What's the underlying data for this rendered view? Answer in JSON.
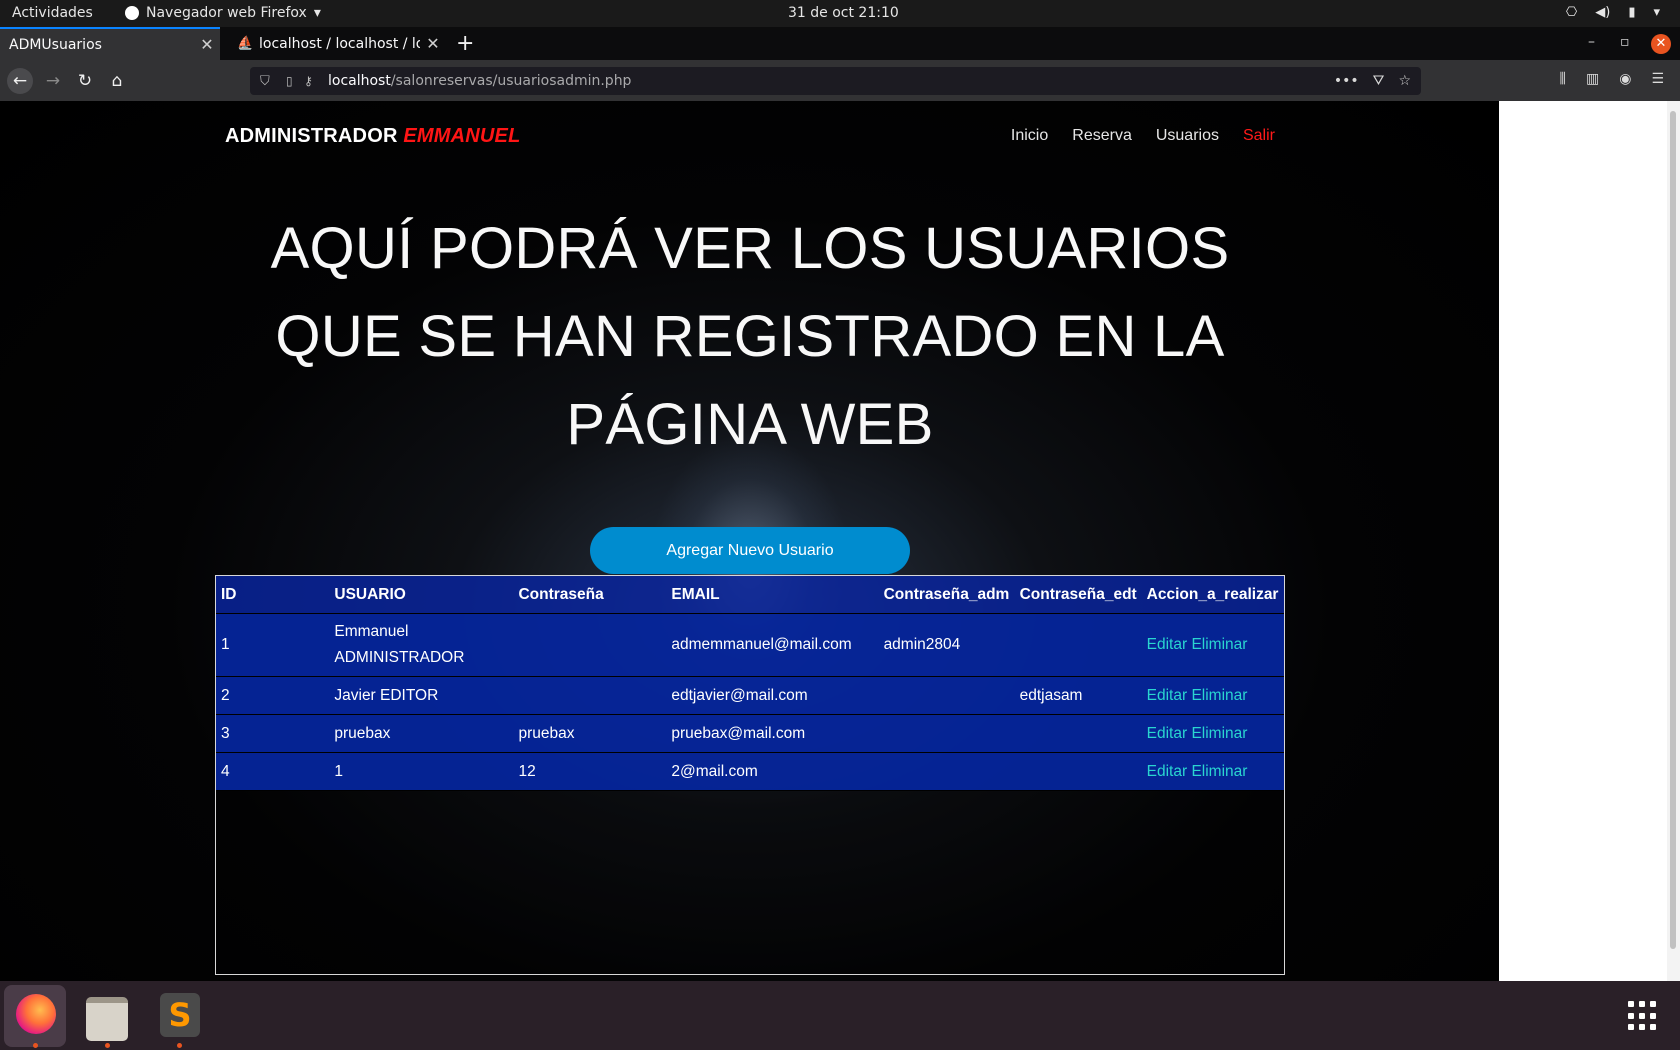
{
  "system": {
    "activities": "Actividades",
    "app_menu": "Navegador web Firefox",
    "clock": "31 de oct  21:10"
  },
  "browser": {
    "tabs": [
      {
        "title": "ADMUsuarios",
        "active": true
      },
      {
        "title": "localhost / localhost / loc",
        "active": false
      }
    ],
    "url_host": "localhost",
    "url_path": "/salonreservas/usuariosadmin.php"
  },
  "site": {
    "brand_prefix": "ADMINISTRADOR",
    "brand_name": "EMMANUEL",
    "nav": [
      "Inicio",
      "Reserva",
      "Usuarios",
      "Salir"
    ],
    "headline": "AQUÍ PODRÁ VER LOS USUARIOS QUE SE HAN REGISTRADO EN LA PÁGINA WEB",
    "add_button": "Agregar Nuevo Usuario",
    "table": {
      "headers": [
        "ID",
        "USUARIO",
        "Contraseña",
        "EMAIL",
        "Contraseña_adm",
        "Contraseña_edt",
        "Accion_a_realizar"
      ],
      "rows": [
        {
          "id": "1",
          "usuario": "Emmanuel ADMINISTRADOR",
          "contrasena": "",
          "email": "admemmanuel@mail.com",
          "contrasena_adm": "admin2804",
          "contrasena_edt": "",
          "editar": "Editar",
          "eliminar": "Eliminar"
        },
        {
          "id": "2",
          "usuario": "Javier EDITOR",
          "contrasena": "",
          "email": "edtjavier@mail.com",
          "contrasena_adm": "",
          "contrasena_edt": "edtjasam",
          "editar": "Editar",
          "eliminar": "Eliminar"
        },
        {
          "id": "3",
          "usuario": "pruebax",
          "contrasena": "pruebax",
          "email": "pruebax@mail.com",
          "contrasena_adm": "",
          "contrasena_edt": "",
          "editar": "Editar",
          "eliminar": "Eliminar"
        },
        {
          "id": "4",
          "usuario": "1",
          "contrasena": "12",
          "email": "2@mail.com",
          "contrasena_adm": "",
          "contrasena_edt": "",
          "editar": "Editar",
          "eliminar": "Eliminar"
        }
      ]
    }
  },
  "colors": {
    "brand_accent": "#ff1515",
    "button_blue": "#008ccf",
    "table_blue": "#0526a0",
    "action_link": "#2ad5d0"
  },
  "icons": [
    "firefox-icon",
    "files-icon",
    "sublime-text-icon",
    "app-grid-icon",
    "shield-icon",
    "star-icon",
    "pocket-icon",
    "library-icon",
    "sidebar-icon",
    "account-icon",
    "menu-icon"
  ]
}
